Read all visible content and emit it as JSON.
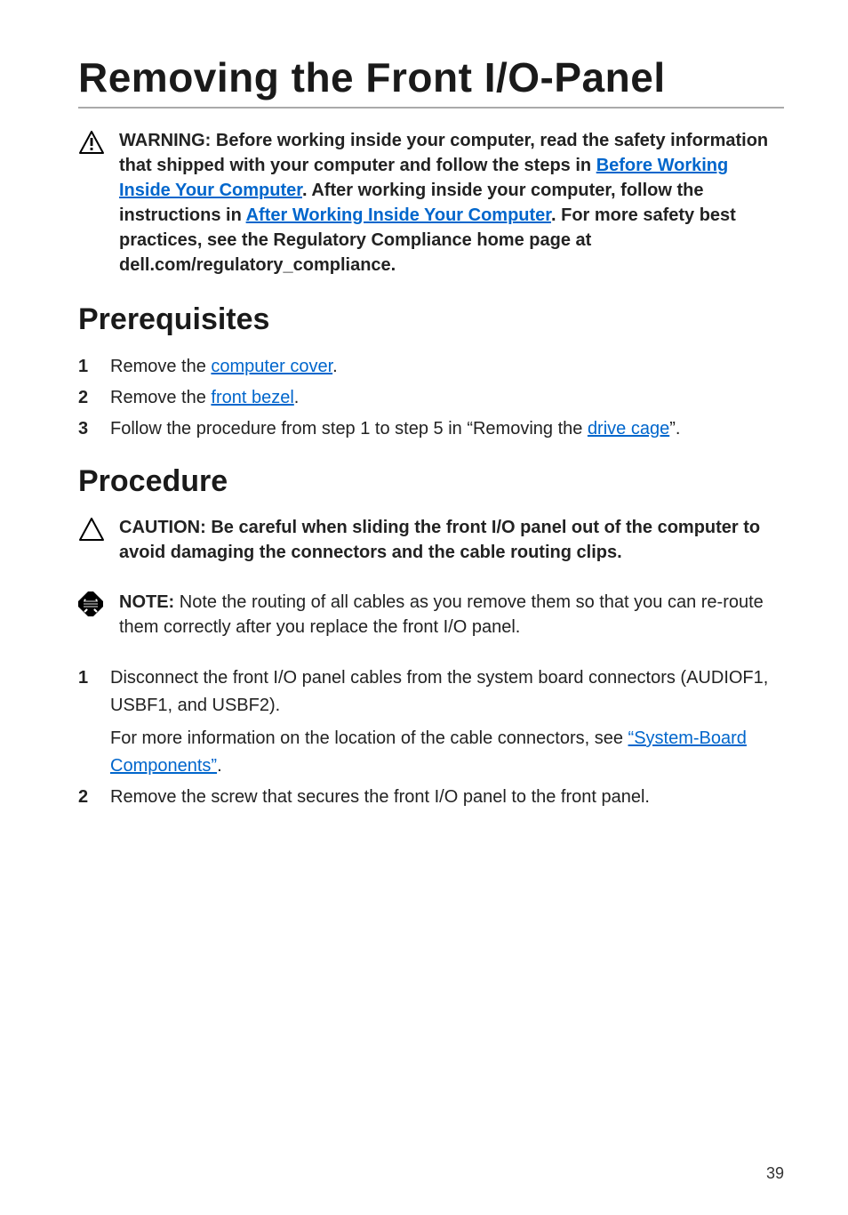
{
  "title": "Removing the Front I/O-Panel",
  "warning": {
    "label": "WARNING: ",
    "part1": "Before working inside your computer, read the safety information that shipped with your computer and follow the steps in ",
    "link1": "Before Working Inside Your Computer",
    "part2": ". After working inside your computer, follow the instructions in ",
    "link2": "After Working Inside Your Computer",
    "part3": ". For more safety best practices, see the Regulatory Compliance home page at dell.com/regulatory_compliance."
  },
  "sections": {
    "prerequisites": {
      "heading": "Prerequisites",
      "steps": [
        {
          "pre": "Remove the ",
          "link": "computer cover",
          "post": "."
        },
        {
          "pre": "Remove the ",
          "link": "front bezel",
          "post": "."
        },
        {
          "pre": "Follow the procedure from step 1 to step 5 in “Removing the ",
          "link": "drive cage",
          "post": "”."
        }
      ]
    },
    "procedure": {
      "heading": "Procedure",
      "caution": "CAUTION: Be careful when sliding the front I/O panel out of the computer to avoid damaging the connectors and the cable routing clips.",
      "note": {
        "label": "NOTE: ",
        "body": "Note the routing of all cables as you remove them so that you can re-route them correctly after you replace the front I/O panel."
      },
      "steps": [
        {
          "main": "Disconnect the front I/O panel cables from the system board connectors (AUDIOF1, USBF1, and USBF2).",
          "sub_pre": "For more information on the location of the cable connectors, see ",
          "sub_link": "“System-Board Components”",
          "sub_post": "."
        },
        {
          "main": "Remove the screw that secures the front I/O panel to the front panel."
        }
      ]
    }
  },
  "page_number": "39"
}
